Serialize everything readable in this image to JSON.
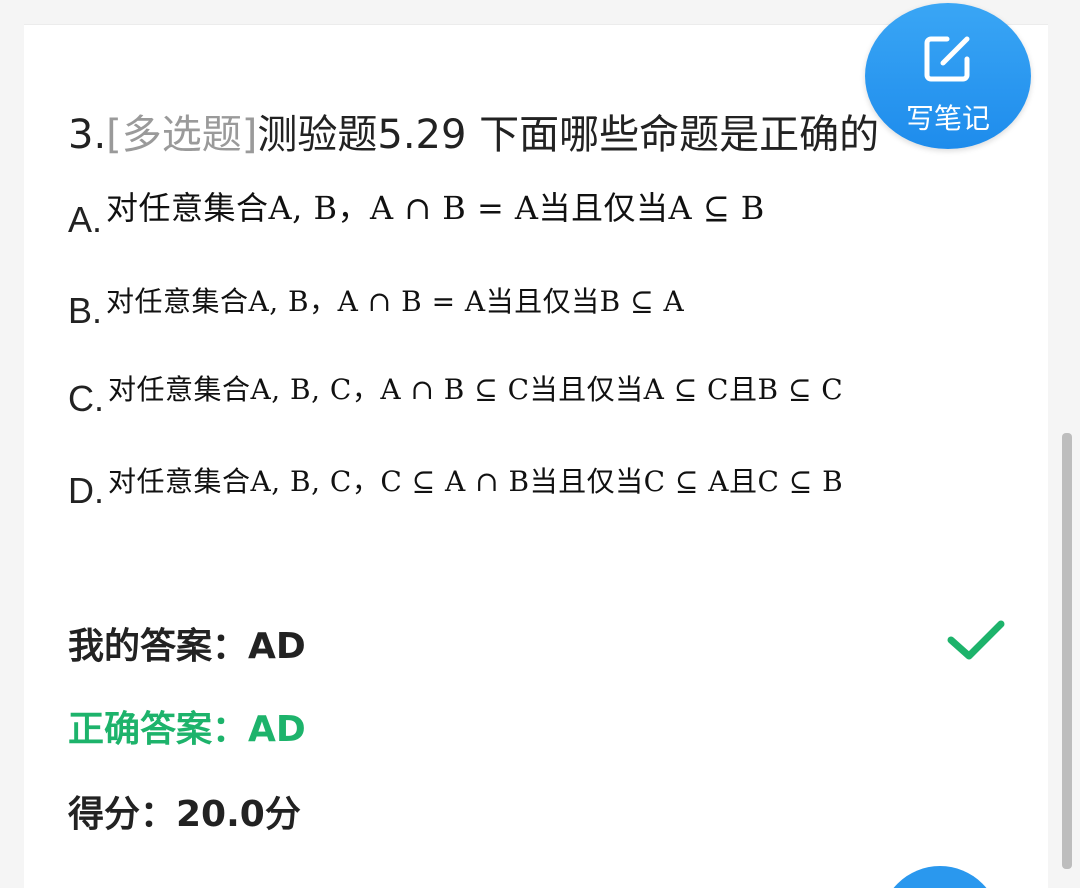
{
  "question": {
    "number": "3.",
    "type": "[多选题]",
    "text": "测验题5.29 下面哪些命题是正确的"
  },
  "options": [
    {
      "letter": "A.",
      "text": "对任意集合A, B，A ∩ B = A当且仅当A ⊆ B"
    },
    {
      "letter": "B.",
      "text": "对任意集合A, B，A ∩ B = A当且仅当B ⊆ A"
    },
    {
      "letter": "C.",
      "text": "对任意集合A, B, C，A ∩ B ⊆ C当且仅当A ⊆ C且B ⊆ C"
    },
    {
      "letter": "D.",
      "text": "对任意集合A, B, C，C ⊆ A ∩ B当且仅当C ⊆ A且C ⊆ B"
    }
  ],
  "result": {
    "my_answer": "我的答案：AD",
    "correct_answer": "正确答案：AD",
    "score": "得分：20.0分"
  },
  "notes_button": {
    "label": "写笔记",
    "icon": "edit-note-icon"
  },
  "status_icon": "checkmark-icon",
  "colors": {
    "correct": "#1db36b",
    "fab": "#2a98ee",
    "question_type": "#9a9a9a"
  }
}
